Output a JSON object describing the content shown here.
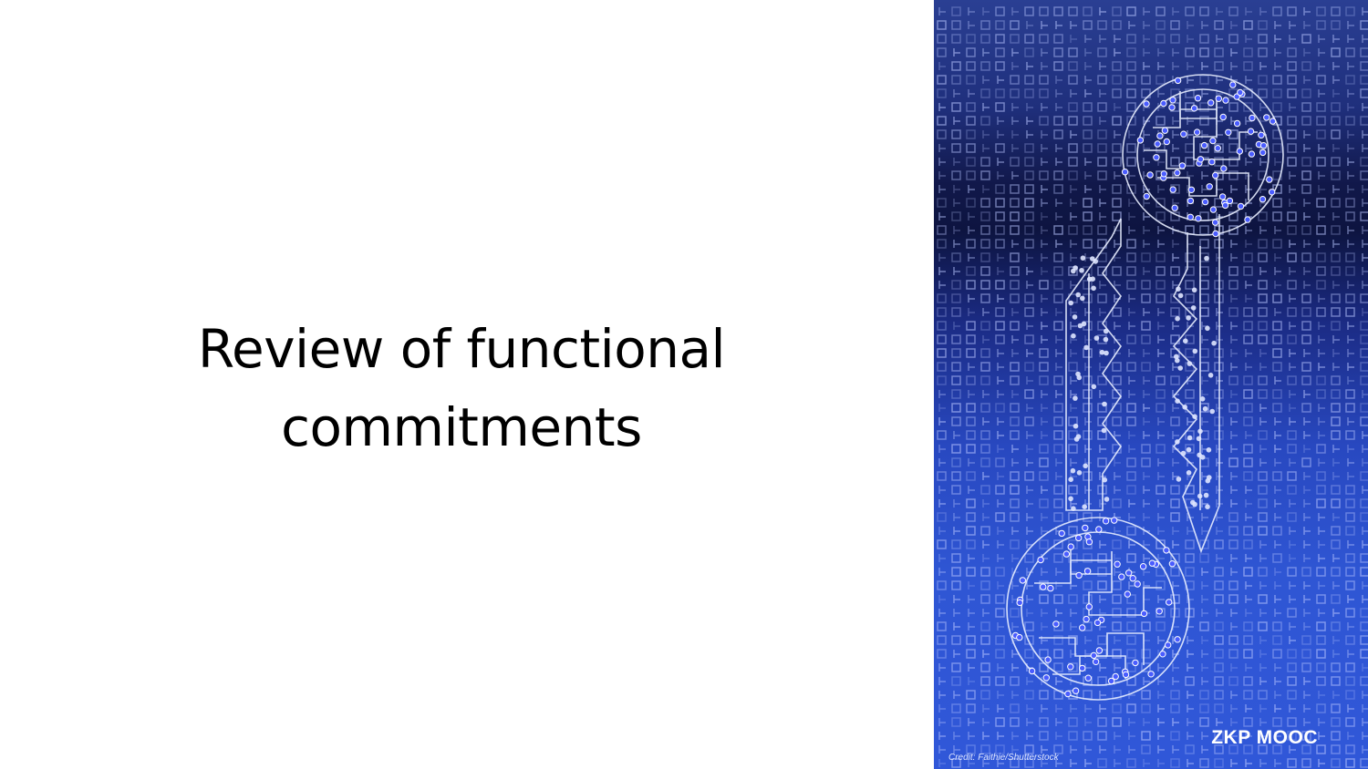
{
  "slide": {
    "title_lines": [
      "Review of functional",
      "commitments"
    ]
  },
  "image_panel": {
    "brand_label": "ZKP MOOC",
    "credit": "Credit: Faithie/Shutterstock",
    "icon": "circuit-keys-icon",
    "colors": {
      "background": "#2848c0",
      "dark_band": "#0d1440",
      "circuit": "#e8eeff",
      "dots": "#4a5cff"
    }
  }
}
